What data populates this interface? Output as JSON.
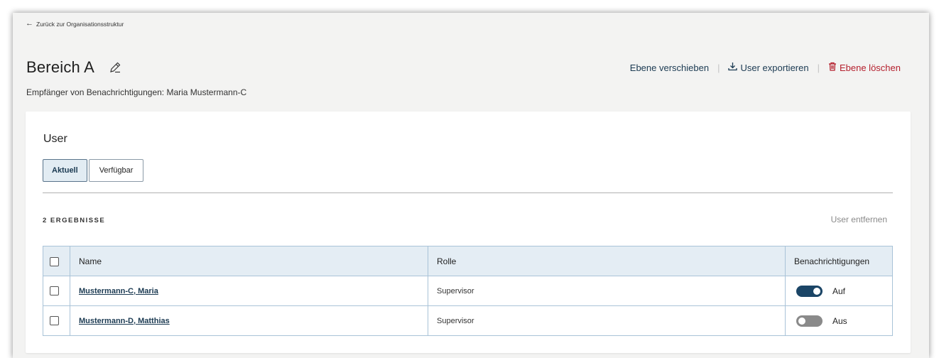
{
  "nav": {
    "back_label": "Zurück zur Organisationsstruktur",
    "back_icon": "arrow-left-icon"
  },
  "header": {
    "title": "Bereich A",
    "recipients": "Empfänger von Benachrichtigungen: Maria Mustermann-C",
    "actions": {
      "move_label": "Ebene verschieben",
      "export_label": "User exportieren",
      "delete_label": "Ebene löschen",
      "separator": "|"
    }
  },
  "users_panel": {
    "title": "User",
    "tabs": [
      {
        "label": "Aktuell",
        "active": true
      },
      {
        "label": "Verfügbar",
        "active": false
      }
    ],
    "results_count": "2 ERGEBNISSE",
    "remove_label": "User entfernen",
    "table": {
      "headers": {
        "name": "Name",
        "role": "Rolle",
        "notifications": "Benachrichtigungen"
      },
      "rows": [
        {
          "name": "Mustermann-C, Maria",
          "role": "Supervisor",
          "notifications_on": true,
          "notifications_label": "Auf"
        },
        {
          "name": "Mustermann-D, Matthias",
          "role": "Supervisor",
          "notifications_on": false,
          "notifications_label": "Aus"
        }
      ]
    }
  },
  "colors": {
    "accent": "#1b3a52",
    "danger": "#b41f2d",
    "toggle_on": "#1b4566",
    "toggle_off": "#8a8a8a",
    "table_header_bg": "#e4edf4",
    "table_border": "#a9c3d8"
  }
}
